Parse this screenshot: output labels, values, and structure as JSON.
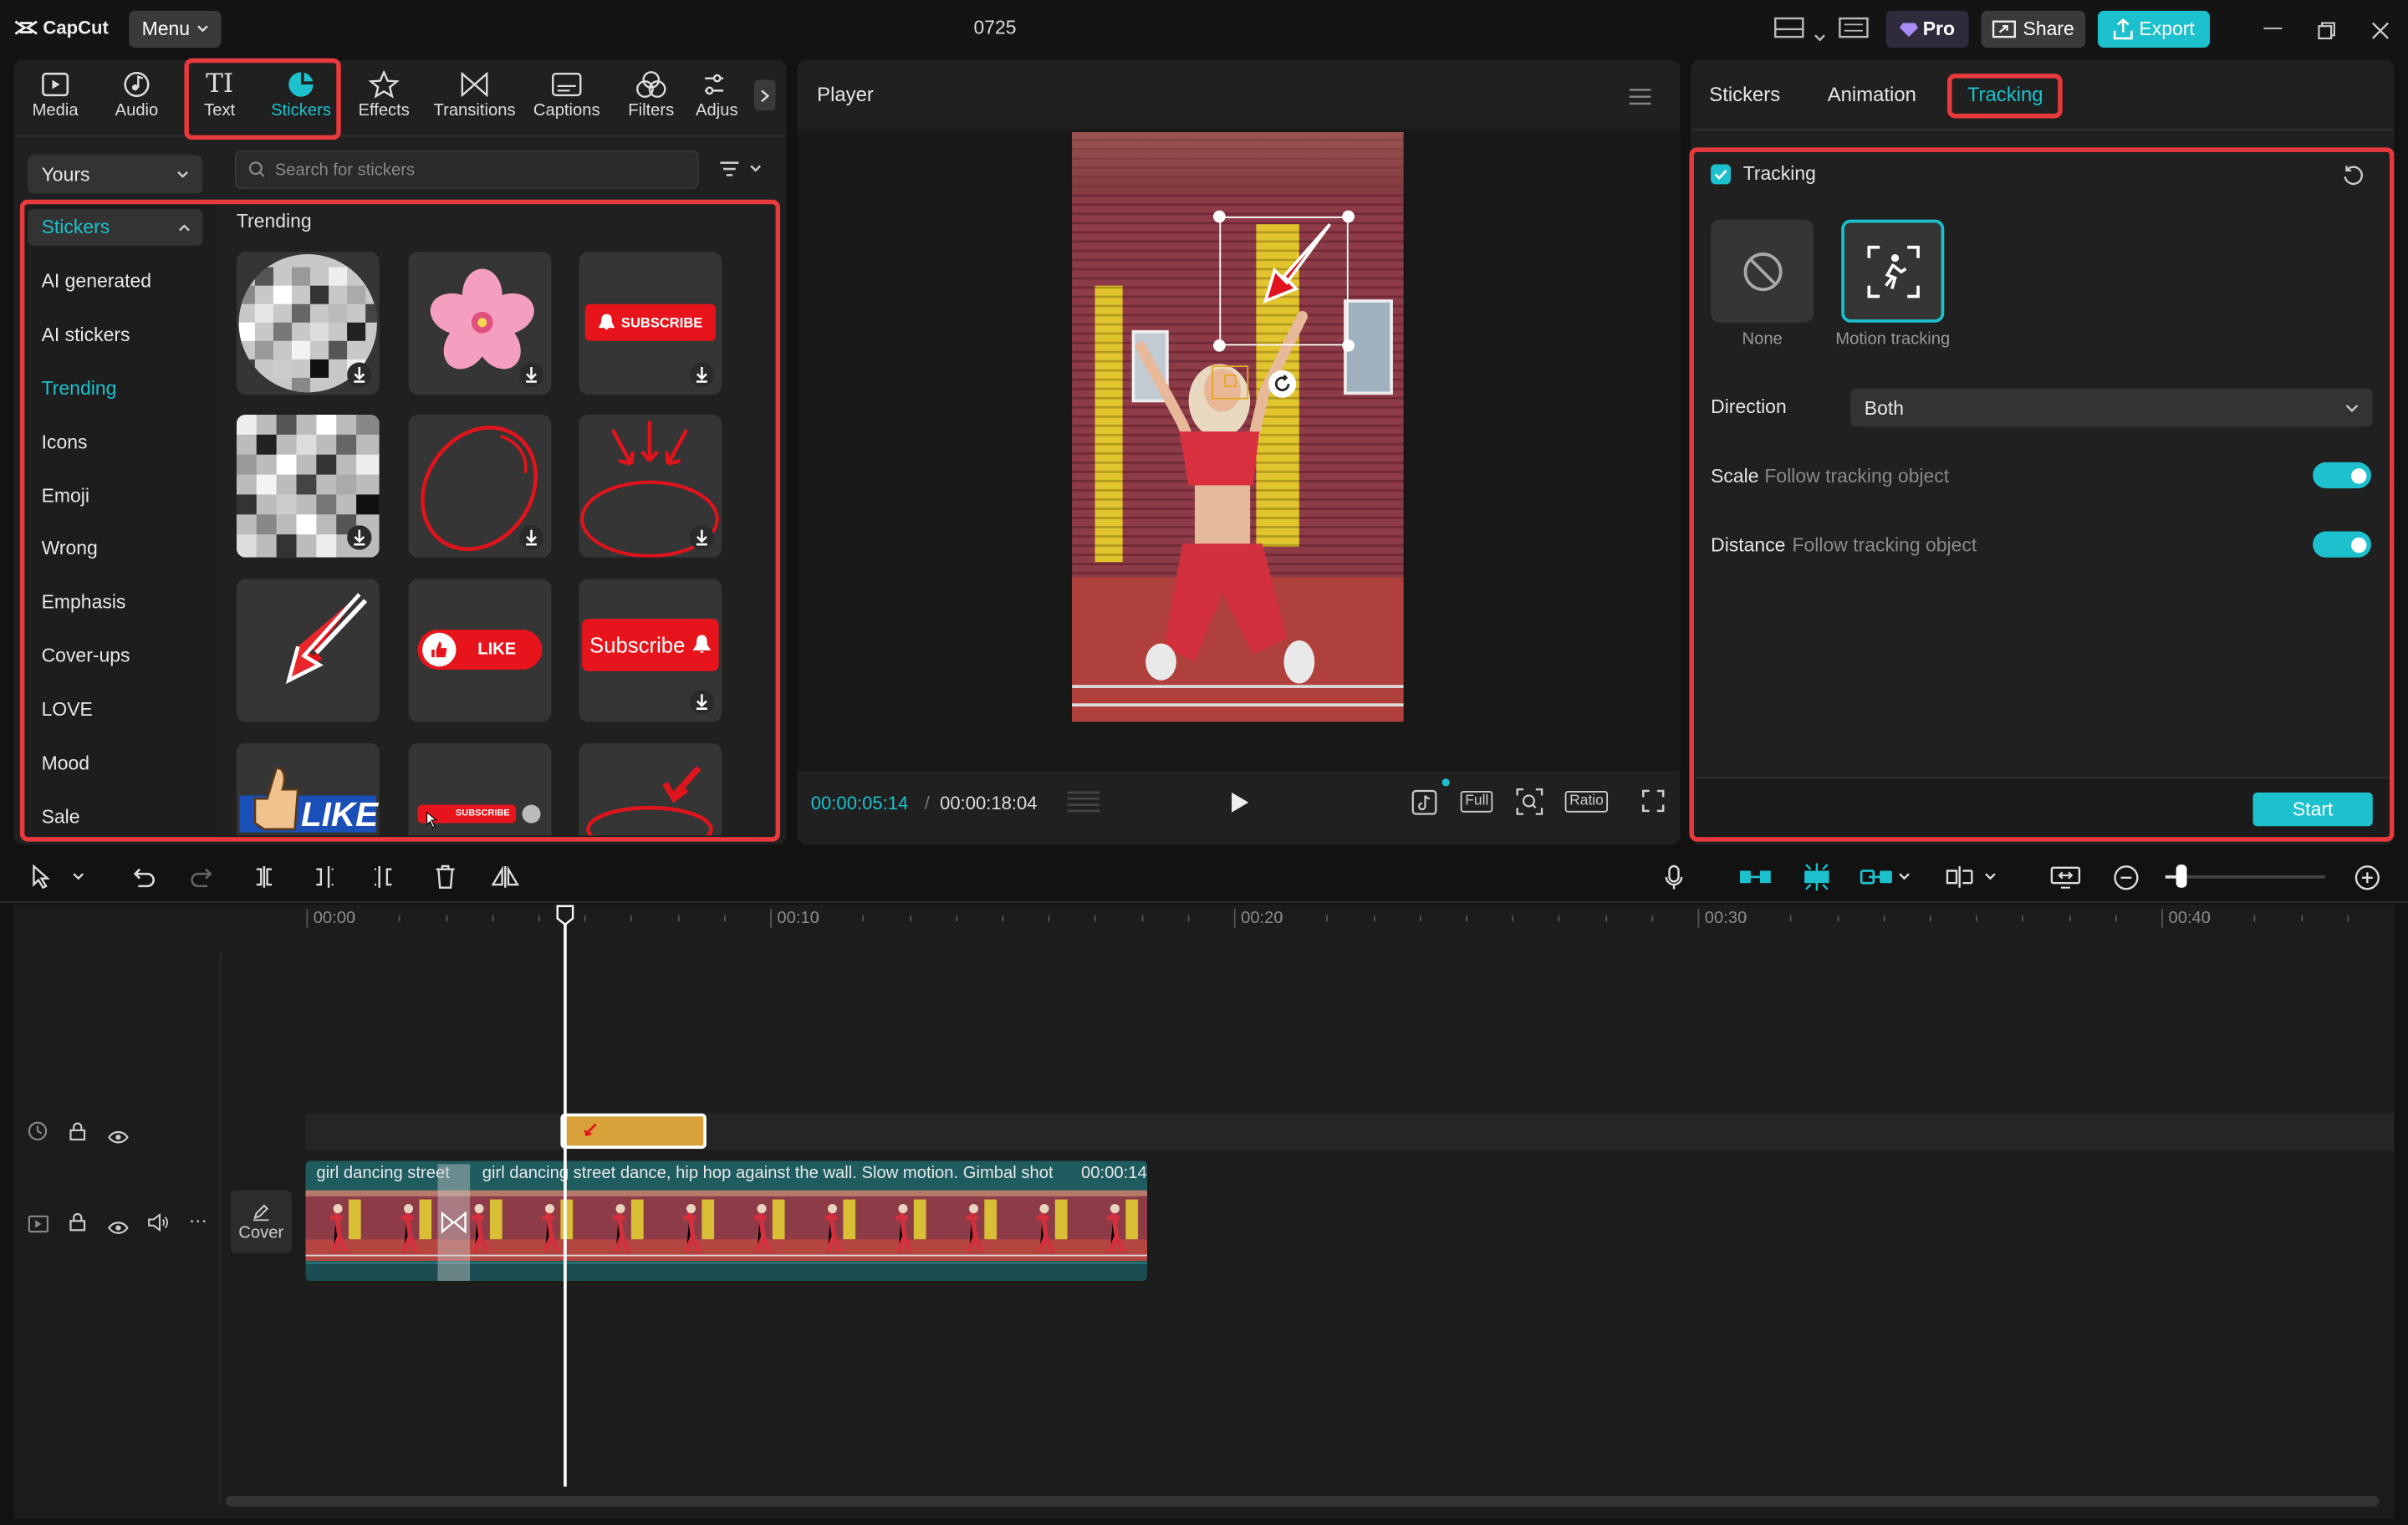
{
  "app": {
    "logo": "CapCut",
    "menu_label": "Menu",
    "project_name": "0725",
    "pro_label": "Pro",
    "share_label": "Share",
    "export_label": "Export"
  },
  "tabs": [
    {
      "label": "Media",
      "icon": "media-icon"
    },
    {
      "label": "Audio",
      "icon": "audio-icon"
    },
    {
      "label": "Text",
      "icon": "text-icon"
    },
    {
      "label": "Stickers",
      "icon": "stickers-icon",
      "active": true
    },
    {
      "label": "Effects",
      "icon": "effects-icon"
    },
    {
      "label": "Transitions",
      "icon": "transitions-icon"
    },
    {
      "label": "Captions",
      "icon": "captions-icon"
    },
    {
      "label": "Filters",
      "icon": "filters-icon"
    },
    {
      "label": "Adjus",
      "icon": "adjust-icon"
    }
  ],
  "library": {
    "source": "Yours",
    "search_placeholder": "Search for stickers",
    "section_title": "Trending",
    "categories": [
      "Stickers",
      "AI generated",
      "AI stickers",
      "Trending",
      "Icons",
      "Emoji",
      "Wrong",
      "Emphasis",
      "Cover-ups",
      "LOVE",
      "Mood",
      "Sale"
    ],
    "active_category": "Trending",
    "sticker_texts": {
      "subscribe_badge": "SUBSCRIBE",
      "like_button": "LIKE",
      "subscribe_button": "Subscribe",
      "like_big": "LIKE",
      "subscribe_small": "SUBSCRIBE"
    }
  },
  "player": {
    "title": "Player",
    "current_time": "00:00:05:14",
    "total_time": "00:00:18:04",
    "full_label": "Full",
    "ratio_label": "Ratio"
  },
  "inspector": {
    "tabs": [
      "Stickers",
      "Animation",
      "Tracking"
    ],
    "active_tab": "Tracking",
    "tracking_label": "Tracking",
    "tracking_enabled": true,
    "options": [
      {
        "label": "None",
        "icon": "none-icon"
      },
      {
        "label": "Motion tracking",
        "icon": "motion-tracking-icon",
        "selected": true
      }
    ],
    "direction_label": "Direction",
    "direction_value": "Both",
    "scale_label": "Scale",
    "scale_hint": "Follow tracking object",
    "scale_on": true,
    "distance_label": "Distance",
    "distance_hint": "Follow tracking object",
    "distance_on": true,
    "start_label": "Start"
  },
  "timeline": {
    "ruler": [
      "00:00",
      "00:10",
      "00:20",
      "00:30",
      "00:40"
    ],
    "clip_title_1": "girl dancing street",
    "clip_title_2": "girl dancing street dance, hip hop against the wall. Slow motion. Gimbal shot",
    "clip_duration": "00:00:14",
    "cover_label": "Cover"
  },
  "colors": {
    "accent": "#1cc1cd",
    "highlight": "#e8393d",
    "sticker_clip": "#d9a13a"
  }
}
